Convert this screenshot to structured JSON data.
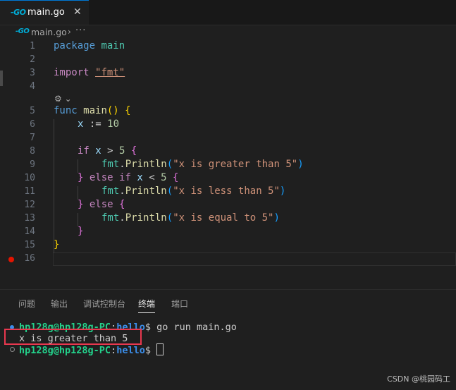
{
  "tab": {
    "icon": "go-file-icon",
    "icon_text": "-GO",
    "title": "main.go",
    "close": "✕"
  },
  "breadcrumb": {
    "icon_text": "-GO",
    "file": "main.go",
    "sep": "›",
    "more": "···"
  },
  "editor": {
    "line_numbers": [
      "1",
      "2",
      "3",
      "4",
      "5",
      "6",
      "7",
      "8",
      "9",
      "10",
      "11",
      "12",
      "13",
      "14",
      "15",
      "16"
    ],
    "lines": {
      "l1": [
        "package",
        "main"
      ],
      "l3": [
        "import",
        "\"fmt\""
      ],
      "l5": [
        "func",
        "main",
        "()",
        "{"
      ],
      "l6": [
        "x",
        ":=",
        "10"
      ],
      "l8": [
        "if",
        "x",
        ">",
        "5",
        "{"
      ],
      "l9": [
        "fmt",
        ".",
        "Println",
        "(",
        "\"x is greater than 5\"",
        ")"
      ],
      "l10": [
        "}",
        "else",
        "if",
        "x",
        "<",
        "5",
        "{"
      ],
      "l11": [
        "fmt",
        ".",
        "Println",
        "(",
        "\"x is less than 5\"",
        ")"
      ],
      "l12": [
        "}",
        "else",
        "{"
      ],
      "l13": [
        "fmt",
        ".",
        "Println",
        "(",
        "\"x is equal to 5\"",
        ")"
      ],
      "l14": [
        "}"
      ],
      "l15": [
        "}"
      ]
    },
    "codelens": "⚙ ⌄"
  },
  "panel": {
    "tabs": [
      "问题",
      "输出",
      "调试控制台",
      "终端",
      "端口"
    ],
    "active_tab": "终端",
    "terminal": {
      "prompt_user": "hp128g@hp128g-PC",
      "prompt_colon": ":",
      "prompt_dir": "hello",
      "prompt_dollar": "$",
      "command": "go run main.go",
      "output": "x is greater than 5"
    }
  },
  "watermark": "CSDN @桃园码工",
  "colors": {
    "accent": "#0078d4",
    "breakpoint": "#e51400",
    "highlight_box": "#e8384f",
    "prompt_green": "#23d18b",
    "prompt_blue": "#3b8eea"
  }
}
